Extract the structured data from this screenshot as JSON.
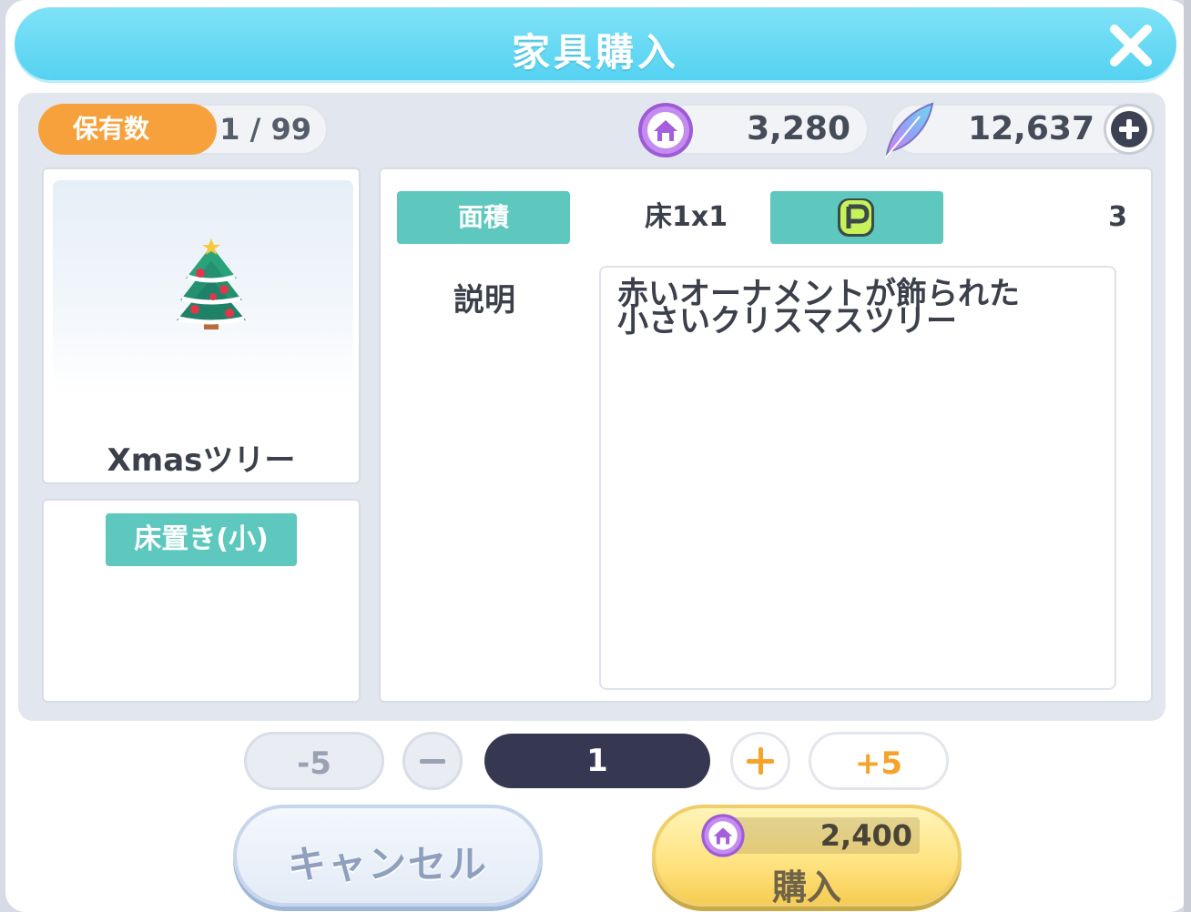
{
  "dialog": {
    "title": "家具購入"
  },
  "owned": {
    "label": "保有数",
    "value": "1 / 99"
  },
  "currencies": {
    "coin": {
      "icon": "house-coin-icon",
      "value": "3,280"
    },
    "feather": {
      "icon": "feather-icon",
      "value": "12,637"
    }
  },
  "item": {
    "name": "Xmasツリー",
    "category": "床置き(小)",
    "area_label": "面積",
    "area_value": "床1x1",
    "point_icon": "p-icon",
    "point_value": "3",
    "description_label": "説明",
    "description": "赤いオーナメントが飾られた\n小さいクリスマスツリー"
  },
  "quantity": {
    "minus5_label": "-5",
    "value": "1",
    "plus5_label": "+5"
  },
  "buttons": {
    "cancel_label": "キャンセル",
    "buy_label": "購入",
    "buy_price": "2,400"
  },
  "colors": {
    "title_bar": "#55d2f1",
    "tag": "#5ec8bf",
    "owned_tag": "#f6a13c",
    "qty_dark": "#363852",
    "accent_orange": "#f5a429"
  }
}
